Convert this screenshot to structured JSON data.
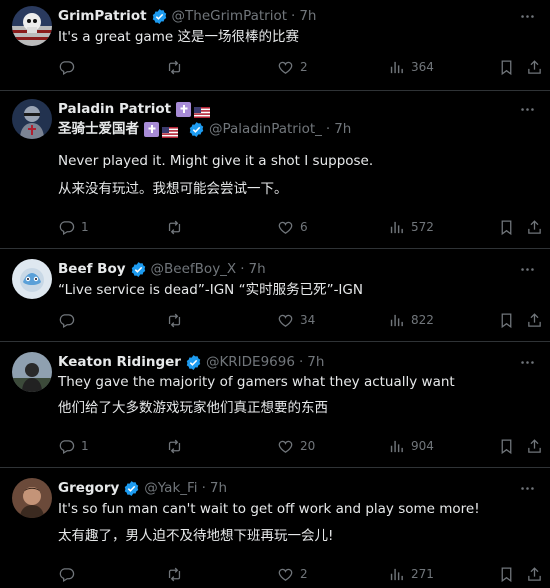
{
  "colors": {
    "background": "#000000",
    "text": "#e7e9ea",
    "muted": "#71767b",
    "verified": "#1d9bf0",
    "divider": "#2f3336"
  },
  "tweets": [
    {
      "name": "GrimPatriot",
      "handle": "@TheGrimPatriot",
      "dot": "·",
      "time": "7h",
      "lines": [
        "It's a great game 这是一场很棒的比赛"
      ],
      "replies": "",
      "retweets": "",
      "likes": "2",
      "views": "364"
    },
    {
      "name": "Paladin Patriot",
      "name2": "圣骑士爱国者",
      "handle": "@PaladinPatriot_",
      "dot": "·",
      "time": "7h",
      "lines": [
        "Never played it. Might give it a shot I suppose.",
        "从来没有玩过。我想可能会尝试一下。"
      ],
      "replies": "1",
      "retweets": "",
      "likes": "6",
      "views": "572"
    },
    {
      "name": "Beef Boy",
      "handle": "@BeefBoy_X",
      "dot": "·",
      "time": "7h",
      "lines": [
        "“Live service is dead”-IGN “实时服务已死”-IGN"
      ],
      "replies": "",
      "retweets": "",
      "likes": "34",
      "views": "822"
    },
    {
      "name": "Keaton Ridinger",
      "handle": "@KRIDE9696",
      "dot": "·",
      "time": "7h",
      "lines": [
        "They gave the majority of gamers what they actually want",
        "他们给了大多数游戏玩家他们真正想要的东西"
      ],
      "replies": "1",
      "retweets": "",
      "likes": "20",
      "views": "904"
    },
    {
      "name": "Gregory",
      "handle": "@Yak_Fi",
      "dot": "·",
      "time": "7h",
      "lines": [
        "It's so fun man can't wait to get off work and play some more!",
        "太有趣了，男人迫不及待地想下班再玩一会儿!"
      ],
      "replies": "",
      "retweets": "",
      "likes": "2",
      "views": "271"
    }
  ]
}
